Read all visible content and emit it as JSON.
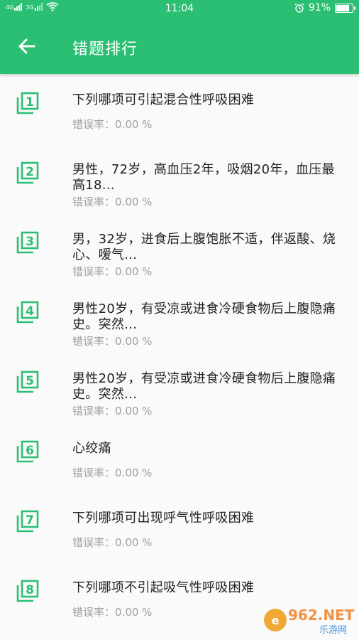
{
  "status_bar": {
    "signal_left": "4G",
    "signal_mid": "3G",
    "time": "11:04",
    "battery_percent": "91%",
    "battery_level": 0.91
  },
  "app_bar": {
    "title": "错题排行"
  },
  "rate_label": "错误率：",
  "items": [
    {
      "rank": "1",
      "question": "下列哪项可引起混合性呼吸困难",
      "rate": "0.00 %"
    },
    {
      "rank": "2",
      "question": "男性，72岁，高血压2年，吸烟20年，血压最高18...",
      "rate": "0.00 %"
    },
    {
      "rank": "3",
      "question": "男，32岁，进食后上腹饱胀不适，伴返酸、烧心、嗳气...",
      "rate": "0.00 %"
    },
    {
      "rank": "4",
      "question": "男性20岁，有受凉或进食冷硬食物后上腹隐痛史。突然...",
      "rate": "0.00 %"
    },
    {
      "rank": "5",
      "question": "男性20岁，有受凉或进食冷硬食物后上腹隐痛史。突然...",
      "rate": "0.00 %"
    },
    {
      "rank": "6",
      "question": "心绞痛",
      "rate": "0.00 %"
    },
    {
      "rank": "7",
      "question": "下列哪项可出现呼气性呼吸困难",
      "rate": "0.00 %"
    },
    {
      "rank": "8",
      "question": "下列哪项不引起吸气性呼吸困难",
      "rate": "0.00 %"
    }
  ],
  "watermark": {
    "brand": "962.NET",
    "sub": "乐游网"
  },
  "colors": {
    "primary": "#2bbf74",
    "text": "#212121",
    "secondary_text": "#9e9e9e"
  }
}
